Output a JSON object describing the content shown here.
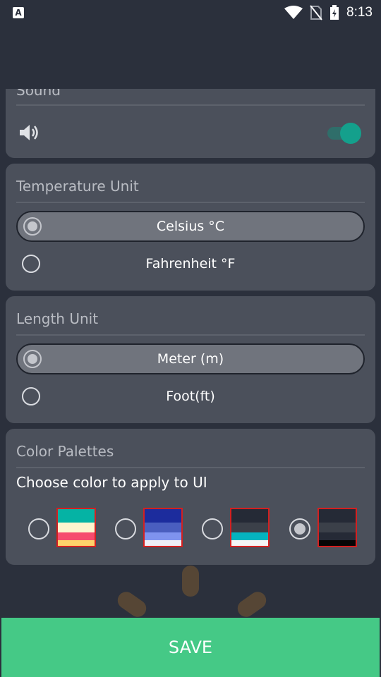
{
  "status_bar": {
    "app_icon": "A",
    "time": "8:13",
    "icons": [
      "wifi-icon",
      "no-sim-icon",
      "battery-charging-icon"
    ]
  },
  "sound": {
    "title": "Sound",
    "icon": "speaker-icon",
    "toggle_on": true
  },
  "temperature": {
    "title": "Temperature Unit",
    "options": [
      "Celsius °C",
      "Fahrenheit °F"
    ],
    "selected": "Celsius °C"
  },
  "length": {
    "title": "Length Unit",
    "options": [
      "Meter (m)",
      "Foot(ft)"
    ],
    "selected": "Meter (m)"
  },
  "palettes": {
    "title": "Color Palettes",
    "subtitle": "Choose color to apply to UI",
    "items": [
      {
        "colors": [
          "#05b3a4",
          "#fdf5cf",
          "#f64b6e",
          "#ffd26a"
        ],
        "checked": false
      },
      {
        "colors": [
          "#1c2c9d",
          "#4a5ebf",
          "#7f93ef",
          "#eef0f8"
        ],
        "checked": false
      },
      {
        "colors": [
          "#252a36",
          "#3b4049",
          "#05b3bf",
          "#f5f5f5"
        ],
        "checked": false
      },
      {
        "colors": [
          "#252a36",
          "#3b4049",
          "#252a36",
          "#050505"
        ],
        "checked": true
      }
    ]
  },
  "save_label": "SAVE"
}
